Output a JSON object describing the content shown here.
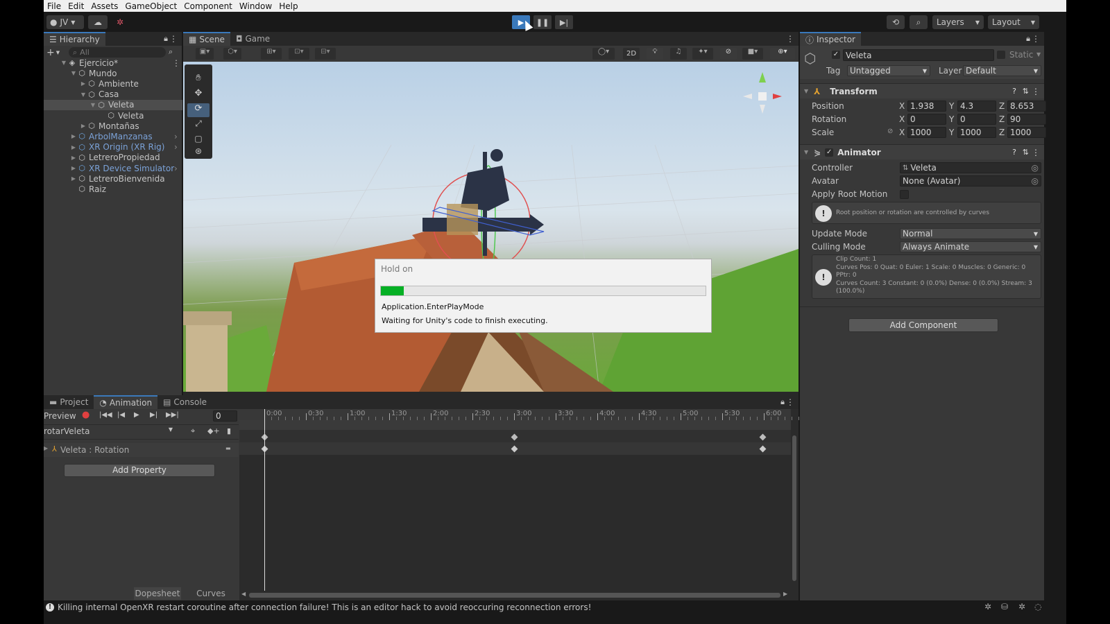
{
  "menu": [
    "File",
    "Edit",
    "Assets",
    "GameObject",
    "Component",
    "Window",
    "Help"
  ],
  "toolbar": {
    "account": "JV",
    "layers": "Layers",
    "layout": "Layout"
  },
  "hierarchy": {
    "tab": "Hierarchy",
    "search_placeholder": "All",
    "items": [
      {
        "label": "Ejercicio*",
        "indent": 0,
        "style": "scene"
      },
      {
        "label": "Mundo",
        "indent": 1
      },
      {
        "label": "Ambiente",
        "indent": 2
      },
      {
        "label": "Casa",
        "indent": 2
      },
      {
        "label": "Veleta",
        "indent": 3,
        "selected": true
      },
      {
        "label": "Veleta",
        "indent": 4
      },
      {
        "label": "Montañas",
        "indent": 2
      },
      {
        "label": "ArbolManzanas",
        "indent": 1,
        "blue": true
      },
      {
        "label": "XR Origin (XR Rig)",
        "indent": 1,
        "blue": true
      },
      {
        "label": "LetreroPropiedad",
        "indent": 1
      },
      {
        "label": "XR Device Simulator",
        "indent": 1,
        "blue": true
      },
      {
        "label": "LetreroBienvenida",
        "indent": 1
      },
      {
        "label": "Raiz",
        "indent": 1
      }
    ]
  },
  "scene": {
    "tabs": [
      "Scene",
      "Game"
    ],
    "toggle_2d": "2D"
  },
  "dialog": {
    "title": "Hold on",
    "progress_pct": 7,
    "line1": "Application.EnterPlayMode",
    "line2": "Waiting for Unity's code to finish executing."
  },
  "inspector": {
    "tab": "Inspector",
    "object_name": "Veleta",
    "static_label": "Static",
    "tag_label": "Tag",
    "tag_value": "Untagged",
    "layer_label": "Layer",
    "layer_value": "Default",
    "transform": {
      "title": "Transform",
      "position_label": "Position",
      "rotation_label": "Rotation",
      "scale_label": "Scale",
      "position": {
        "x": "1.938",
        "y": "4.3",
        "z": "8.653"
      },
      "rotation": {
        "x": "0",
        "y": "0",
        "z": "90"
      },
      "scale": {
        "x": "1000",
        "y": "1000",
        "z": "1000"
      }
    },
    "animator": {
      "title": "Animator",
      "controller_label": "Controller",
      "controller_value": "Veleta",
      "avatar_label": "Avatar",
      "avatar_value": "None (Avatar)",
      "apply_root_motion_label": "Apply Root Motion",
      "root_info": "Root position or rotation are controlled by curves",
      "update_mode_label": "Update Mode",
      "update_mode_value": "Normal",
      "culling_mode_label": "Culling Mode",
      "culling_mode_value": "Always Animate",
      "clip_info": [
        "Clip Count: 1",
        "Curves Pos: 0 Quat: 0 Euler: 1 Scale: 0 Muscles: 0 Generic: 0",
        "PPtr: 0",
        "Curves Count: 3 Constant: 0 (0.0%) Dense: 0 (0.0%) Stream: 3",
        "(100.0%)"
      ]
    },
    "add_component": "Add Component"
  },
  "bottom": {
    "tabs": [
      "Project",
      "Animation",
      "Console"
    ],
    "preview_label": "Preview",
    "frame_value": "0",
    "clip_name": "rotarVeleta",
    "property": "Veleta : Rotation",
    "add_property": "Add Property",
    "dopesheet": "Dopesheet",
    "curves": "Curves",
    "ruler": [
      "0:00",
      "0:30",
      "1:00",
      "1:30",
      "2:00",
      "2:30",
      "3:00",
      "3:30",
      "4:00",
      "4:30",
      "5:00",
      "5:30",
      "6:00"
    ]
  },
  "status": {
    "message": "Killing internal OpenXR restart coroutine after connection failure! This is an editor hack to avoid reoccuring reconnection errors!"
  },
  "colors": {
    "accent": "#3a79bb",
    "progress": "#06b025",
    "panel": "#383838",
    "dark": "#282828",
    "link_blue": "#7ba2d8"
  }
}
